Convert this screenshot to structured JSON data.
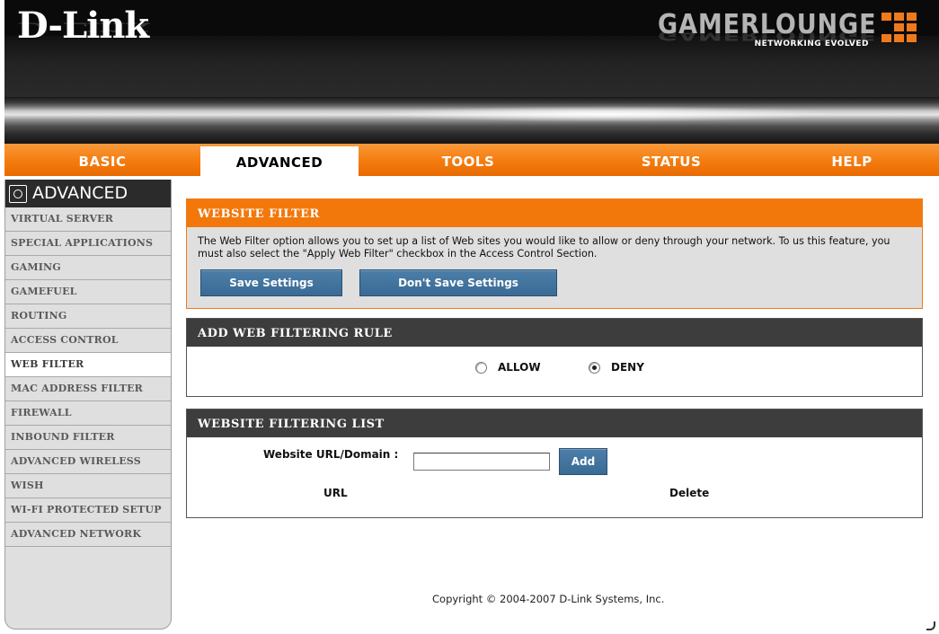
{
  "header": {
    "brand_logo": "D-Link",
    "product_logo": "GAMERLOUNGE",
    "product_tagline": "NETWORKING EVOLVED"
  },
  "nav": {
    "tabs": [
      {
        "label": "BASIC"
      },
      {
        "label": "ADVANCED"
      },
      {
        "label": "TOOLS"
      },
      {
        "label": "STATUS"
      },
      {
        "label": "HELP"
      }
    ],
    "active": "ADVANCED"
  },
  "sidebar": {
    "title": "ADVANCED",
    "items": [
      {
        "label": "VIRTUAL SERVER"
      },
      {
        "label": "SPECIAL APPLICATIONS"
      },
      {
        "label": "GAMING"
      },
      {
        "label": "GAMEFUEL"
      },
      {
        "label": "ROUTING"
      },
      {
        "label": "ACCESS CONTROL"
      },
      {
        "label": "WEB FILTER"
      },
      {
        "label": "MAC ADDRESS FILTER"
      },
      {
        "label": "FIREWALL"
      },
      {
        "label": "INBOUND FILTER"
      },
      {
        "label": "ADVANCED WIRELESS"
      },
      {
        "label": "WISH"
      },
      {
        "label": "WI-FI PROTECTED SETUP"
      },
      {
        "label": "ADVANCED NETWORK"
      }
    ],
    "active": "WEB FILTER"
  },
  "website_filter": {
    "title": "WEBSITE FILTER",
    "description": "The Web Filter option allows you to set up a list of Web sites you would like to allow or deny through your network. To us this feature, you must also select the \"Apply Web Filter\" checkbox in the Access Control Section.",
    "save_label": "Save Settings",
    "dont_save_label": "Don't Save Settings"
  },
  "add_rule": {
    "title": "ADD WEB FILTERING RULE",
    "allow_label": "ALLOW",
    "deny_label": "DENY",
    "selected": "DENY"
  },
  "filter_list": {
    "title": "WEBSITE FILTERING LIST",
    "url_label": "Website URL/Domain :",
    "url_value": "",
    "add_label": "Add",
    "col_url": "URL",
    "col_delete": "Delete"
  },
  "footer": {
    "copyright": "Copyright © 2004-2007 D-Link Systems, Inc."
  },
  "colors": {
    "accent_orange": "#f57e11",
    "button_blue": "#3a6b95",
    "panel_header_dark": "#3d3d3d"
  }
}
